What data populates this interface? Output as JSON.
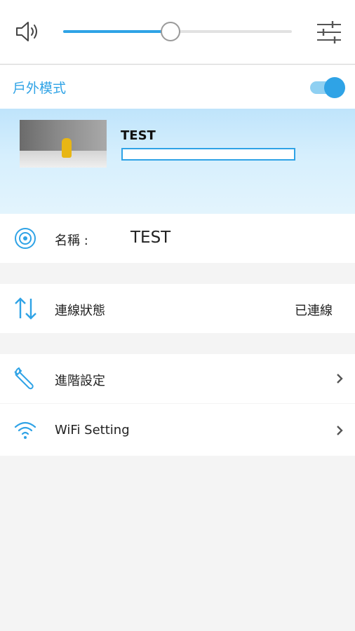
{
  "volume": {
    "level": 0.47,
    "speaker_icon": "speaker-icon",
    "settings_icon": "equalizer-icon"
  },
  "outdoor_mode": {
    "label": "戶外模式",
    "enabled": true
  },
  "device": {
    "title": "TEST"
  },
  "rows": {
    "name": {
      "label": "名稱 :",
      "value": "TEST",
      "icon": "target-icon"
    },
    "connection": {
      "label": "連線狀態",
      "value": "已連線",
      "icon": "arrows-updown-icon"
    },
    "advanced": {
      "label": "進階設定",
      "icon": "wrench-icon"
    },
    "wifi": {
      "label": "WiFi Setting",
      "icon": "wifi-icon"
    }
  },
  "colors": {
    "accent": "#2fa3e6",
    "background": "#f4f4f4"
  }
}
